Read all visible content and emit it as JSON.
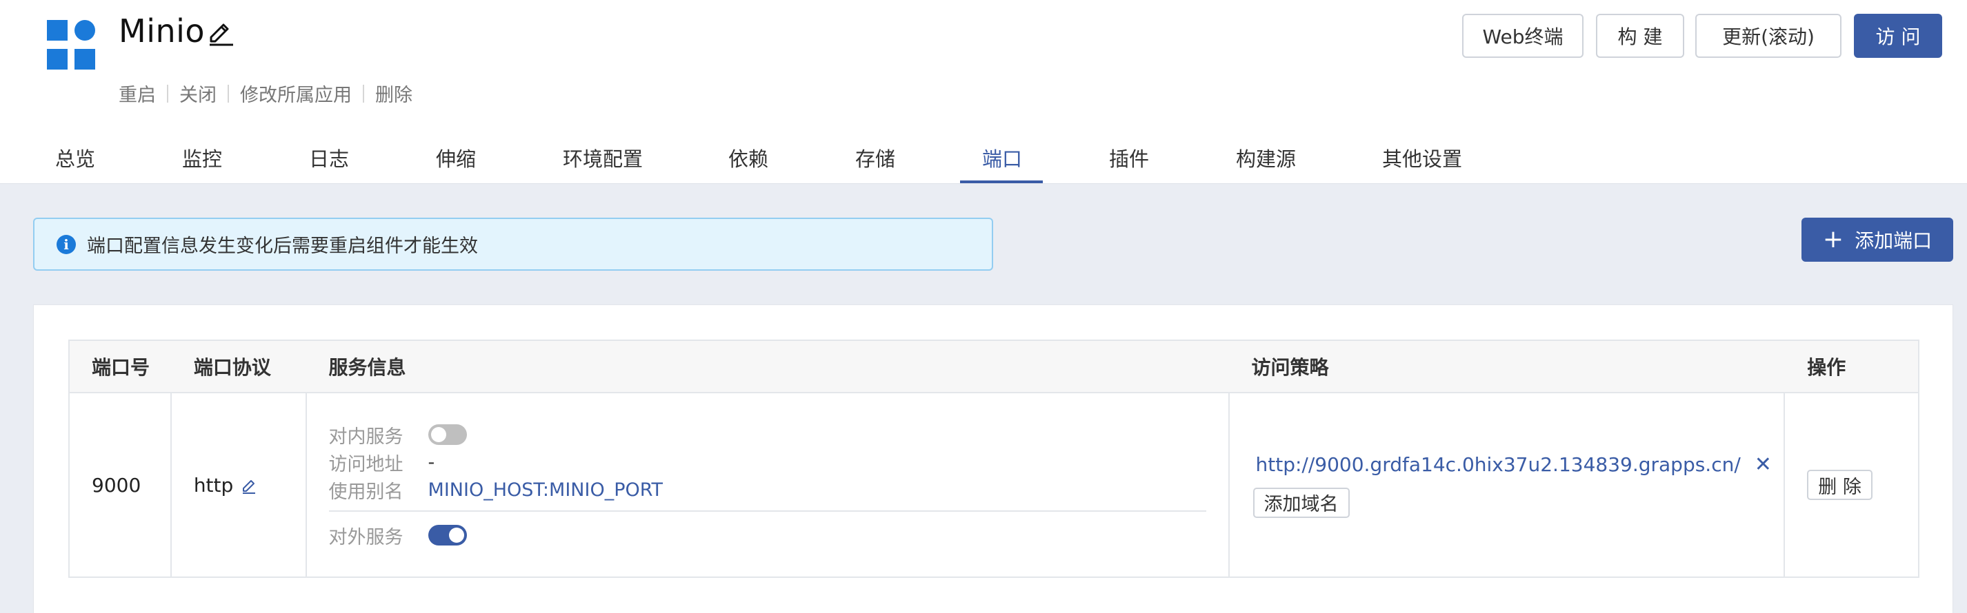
{
  "app": {
    "title": "Minio",
    "actions": [
      "重启",
      "关闭",
      "修改所属应用",
      "删除"
    ]
  },
  "header_buttons": {
    "web_terminal": "Web终端",
    "build": "构 建",
    "update": "更新(滚动)",
    "visit": "访 问"
  },
  "tabs": [
    "总览",
    "监控",
    "日志",
    "伸缩",
    "环境配置",
    "依赖",
    "存储",
    "端口",
    "插件",
    "构建源",
    "其他设置"
  ],
  "active_tab": "端口",
  "alert": {
    "icon": "info-icon",
    "text": "端口配置信息发生变化后需要重启组件才能生效"
  },
  "add_port_button": "添加端口",
  "table": {
    "headers": [
      "端口号",
      "端口协议",
      "服务信息",
      "访问策略",
      "操作"
    ],
    "rows": [
      {
        "port": "9000",
        "protocol": "http",
        "internal_label": "对内服务",
        "internal_enabled": false,
        "address_label": "访问地址",
        "address_value": "-",
        "alias_label": "使用别名",
        "alias_value": "MINIO_HOST:MINIO_PORT",
        "external_label": "对外服务",
        "external_enabled": true,
        "domain": "http://9000.grdfa14c.0hix37u2.134839.grapps.cn/",
        "add_domain_label": "添加域名",
        "delete_label": "删 除"
      }
    ]
  },
  "colors": {
    "primary": "#3a5ca6",
    "logo": "#1b7ad9",
    "alert_bg": "#e3f4fd"
  }
}
